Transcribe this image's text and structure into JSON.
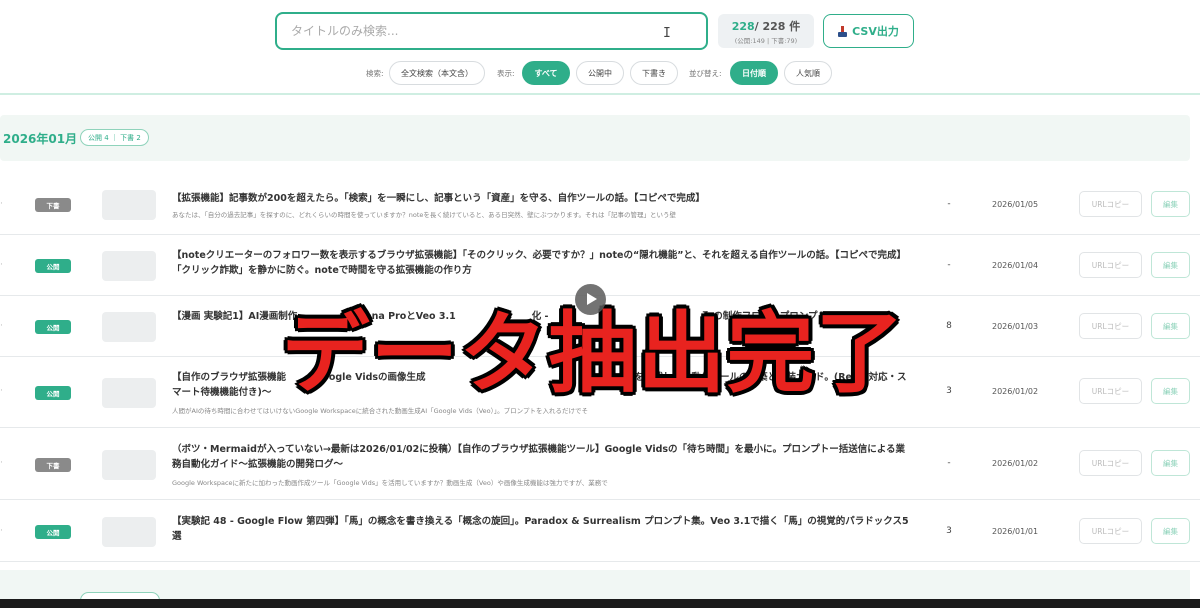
{
  "search": {
    "placeholder": "タイトルのみ検索...",
    "value": ""
  },
  "count": {
    "shown": "228",
    "total": "/ 228 件",
    "breakdown": "(公開:149 | 下書:79)"
  },
  "toolbar": {
    "csv_label": "CSV出力"
  },
  "filters": {
    "search_label": "検索:",
    "search_mode": "全文検索（本文含）",
    "display_label": "表示:",
    "display_all": "すべて",
    "display_published": "公開中",
    "display_draft": "下書き",
    "sort_label": "並び替え:",
    "sort_date": "日付順",
    "sort_popular": "人気順"
  },
  "month": {
    "title": "2026年01月",
    "badge": "公開 4 ｜ 下書 2"
  },
  "rows": [
    {
      "status": "下書",
      "status_type": "draft",
      "title": "【拡張機能】記事数が200を超えたら。「検索」を一瞬にし、記事という「資産」を守る、自作ツールの話。【コピペで完成】",
      "desc": "あなたは、「自分の過去記事」を探すのに、どれくらいの時間を使っていますか？noteを長く続けていると、ある日突然、壁にぶつかります。それは「記事の管理」という壁",
      "likes": "-",
      "date": "2026/01/05"
    },
    {
      "status": "公開",
      "status_type": "pub",
      "title": "【noteクリエーターのフォロワー数を表示するブラウザ拡張機能】「そのクリック、必要ですか？」noteの“隠れ機能”と、それを超える自作ツールの話。【コピペで完成】「クリック詐欺」を静かに防ぐ。noteで時間を守る拡張機能の作り方",
      "desc": "",
      "likes": "-",
      "date": "2026/01/04"
    },
    {
      "status": "公開",
      "status_type": "pub",
      "title": "【漫画 実験記1】AI漫画制作　　　　　Banana ProとVeo 3.1　　　　　　　　化 -　　　　　　　　　　　　　　　　そ の制作フローとプロンプト",
      "desc": "",
      "likes": "8",
      "date": "2026/01/03"
    },
    {
      "status": "公開",
      "status_type": "pub",
      "title": "【自作のブラウザ拡張機能　　　Google Vidsの画像生成　　　　　　　　　　　　　　　　　　　　　　を搭載した自動化ツールの構築と実装ガイド。(React対応・スマート待機機能付き)〜",
      "desc": "人間がAIの待ち時間に合わせてはいけないGoogle Workspaceに統合された動画生成AI「Google Vids（Veo）」。プロンプトを入れるだけでそ",
      "likes": "3",
      "date": "2026/01/02"
    },
    {
      "status": "下書",
      "status_type": "draft",
      "title": "（ボツ・Mermaidが入っていない→最新は2026/01/02に投稿）【自作のブラウザ拡張機能ツール】Google Vidsの「待ち時間」を最小に。プロンプトー括送信による業務自動化ガイド〜拡張機能の開発ログ〜",
      "desc": "Google Workspaceに新たに加わった動画作成ツール「Google Vids」を活用していますか？動画生成（Veo）や画像生成機能は強力ですが、業務で",
      "likes": "-",
      "date": "2026/01/02"
    },
    {
      "status": "公開",
      "status_type": "pub",
      "title": "【実験記 48 - Google Flow 第四弾】「馬」の概念を書き換える「概念の旋回」。Paradox & Surrealism プロンプト集。Veo 3.1で描く「馬」の視覚的パラドックス5選",
      "desc": "",
      "likes": "3",
      "date": "2026/01/01"
    }
  ],
  "row_buttons": {
    "url_copy": "URLコピー",
    "edit": "編集"
  },
  "overlay": {
    "caption": "データ抽出完了"
  },
  "colors": {
    "accent": "#2fae8a",
    "draft": "#8a8a8a",
    "caption": "#e8231f"
  }
}
